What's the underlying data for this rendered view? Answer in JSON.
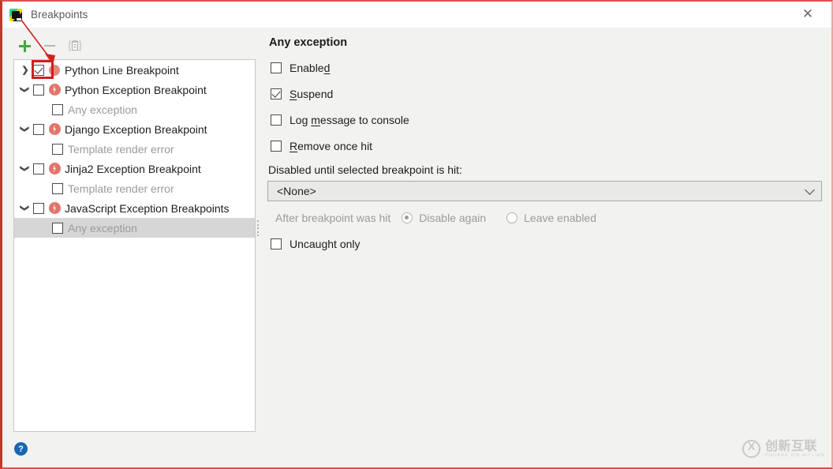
{
  "window": {
    "title": "Breakpoints",
    "app_icon": "pycharm-icon",
    "close_label": "✕"
  },
  "toolbar": {
    "add_label": "+",
    "remove_label": "−",
    "copy_label": "copy-to-clipboard"
  },
  "tree": {
    "items": [
      {
        "label": "Python Line Breakpoint",
        "arrow": "collapsed",
        "checked": true,
        "icon": "breakpoint-dot-icon",
        "muted": false,
        "level": 0,
        "selected": false
      },
      {
        "label": "Python Exception Breakpoint",
        "arrow": "expanded",
        "checked": false,
        "icon": "exception-bolt-icon",
        "muted": false,
        "level": 0,
        "selected": false
      },
      {
        "label": "Any exception",
        "arrow": "none",
        "checked": false,
        "icon": "none",
        "muted": true,
        "level": 1,
        "selected": false
      },
      {
        "label": "Django Exception Breakpoint",
        "arrow": "expanded",
        "checked": false,
        "icon": "exception-bolt-icon",
        "muted": false,
        "level": 0,
        "selected": false
      },
      {
        "label": "Template render error",
        "arrow": "none",
        "checked": false,
        "icon": "none",
        "muted": true,
        "level": 1,
        "selected": false
      },
      {
        "label": "Jinja2 Exception Breakpoint",
        "arrow": "expanded",
        "checked": false,
        "icon": "exception-bolt-icon",
        "muted": false,
        "level": 0,
        "selected": false
      },
      {
        "label": "Template render error",
        "arrow": "none",
        "checked": false,
        "icon": "none",
        "muted": true,
        "level": 1,
        "selected": false
      },
      {
        "label": "JavaScript Exception Breakpoints",
        "arrow": "expanded",
        "checked": false,
        "icon": "exception-bolt-icon",
        "muted": false,
        "level": 0,
        "selected": false
      },
      {
        "label": "Any exception",
        "arrow": "none",
        "checked": false,
        "icon": "none",
        "muted": true,
        "level": 1,
        "selected": true
      }
    ]
  },
  "details": {
    "title": "Any exception",
    "options": [
      {
        "label_pre": "Enable",
        "label_mnemonic": "d",
        "label_post": "",
        "checked": false,
        "name": "enabled"
      },
      {
        "label_pre": "",
        "label_mnemonic": "S",
        "label_post": "uspend",
        "checked": true,
        "name": "suspend"
      },
      {
        "label_pre": "Log ",
        "label_mnemonic": "m",
        "label_post": "essage to console",
        "checked": false,
        "name": "log-message-to-console"
      },
      {
        "label_pre": "",
        "label_mnemonic": "R",
        "label_post": "emove once hit",
        "checked": false,
        "name": "remove-once-hit"
      }
    ],
    "disabled_until_label": "Disabled until selected breakpoint is hit:",
    "breakpoint_select_value": "<None>",
    "after_hit_label": "After breakpoint was hit",
    "after_hit_options": [
      {
        "label": "Disable again",
        "selected": true
      },
      {
        "label": "Leave enabled",
        "selected": false
      }
    ],
    "uncaught_only": {
      "label": "Uncaught only",
      "checked": false
    }
  },
  "footer": {
    "help_label": "?",
    "watermark_cn": "创新互联",
    "watermark_pinyin": "CHUANG XIN HU LIAN"
  },
  "colors": {
    "accent_red": "#cf2020",
    "breakpoint_dot": "#e08a80",
    "exception_icon": "#e2746a",
    "help_blue": "#1667b3",
    "selection_gray": "#d6d6d6",
    "panel_bg": "#f2f2f0"
  }
}
